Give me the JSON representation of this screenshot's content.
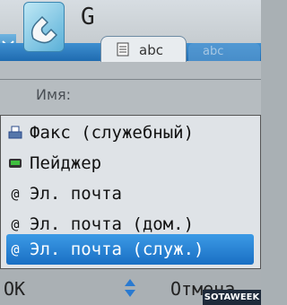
{
  "header": {
    "app_title": "G",
    "contact_icon": "phonebook-contact-icon",
    "signal_icon": "signal-antenna-icon"
  },
  "tabs": [
    {
      "label": "abc",
      "icon": "notepad-icon",
      "active": true
    },
    {
      "label": "abc",
      "active": false
    }
  ],
  "form": {
    "name_label": "Имя:"
  },
  "popup": {
    "items": [
      {
        "label": "Факс (служебный)",
        "icon": "fax-icon",
        "selected": false
      },
      {
        "label": "Пейджер",
        "icon": "pager-icon",
        "selected": false
      },
      {
        "label": "Эл. почта",
        "icon": "email-at-icon",
        "selected": false
      },
      {
        "label": "Эл. почта (дом.)",
        "icon": "email-at-icon",
        "selected": false
      },
      {
        "label": "Эл. почта (служ.)",
        "icon": "email-at-icon",
        "selected": true
      }
    ]
  },
  "softkeys": {
    "left": "OK",
    "right": "Отмена",
    "nav_icon": "up-down-arrows-icon"
  },
  "watermark": "SOTAWEEK",
  "colors": {
    "selection": "#1a6fc4",
    "tabstrip": "#1f6bb0",
    "popup_bg": "#dfe3e7"
  }
}
